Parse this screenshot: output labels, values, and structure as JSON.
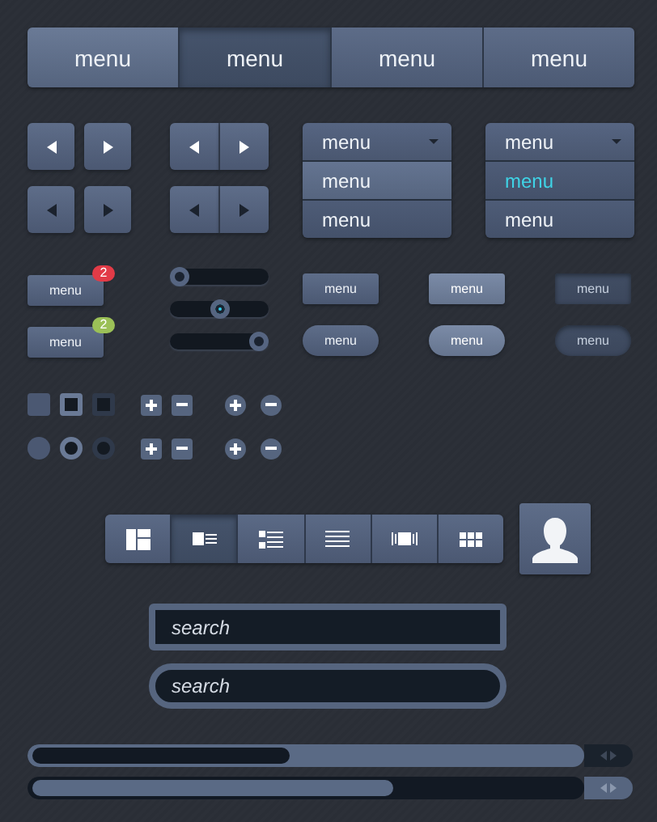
{
  "tabs": [
    {
      "label": "menu",
      "selected": false
    },
    {
      "label": "menu",
      "selected": true
    },
    {
      "label": "menu",
      "selected": false
    },
    {
      "label": "menu",
      "selected": false
    }
  ],
  "pagers": [
    {
      "joined": false,
      "dark_arrows": false
    },
    {
      "joined": true,
      "dark_arrows": false
    },
    {
      "joined": false,
      "dark_arrows": true
    },
    {
      "joined": true,
      "dark_arrows": true
    }
  ],
  "dropdowns": [
    {
      "label": "menu",
      "items": [
        {
          "label": "menu",
          "hovered": true,
          "selected": false
        },
        {
          "label": "menu",
          "hovered": false,
          "selected": false
        }
      ]
    },
    {
      "label": "menu",
      "items": [
        {
          "label": "menu",
          "hovered": false,
          "selected": true
        },
        {
          "label": "menu",
          "hovered": false,
          "selected": false
        }
      ]
    }
  ],
  "badge_buttons": [
    {
      "label": "menu",
      "badge": "2",
      "color": "#e23b47"
    },
    {
      "label": "menu",
      "badge": "2",
      "color": "#9bc057"
    }
  ],
  "sliders": [
    {
      "level": 0,
      "active": false
    },
    {
      "level": 0.5,
      "active": true
    },
    {
      "level": 1,
      "active": false
    }
  ],
  "buttons": [
    {
      "label": "menu",
      "kind": "square",
      "hovered": false,
      "pressed": false
    },
    {
      "label": "menu",
      "kind": "square",
      "hovered": true,
      "pressed": false
    },
    {
      "label": "menu",
      "kind": "square",
      "hovered": false,
      "pressed": true
    },
    {
      "label": "menu",
      "kind": "round",
      "hovered": false,
      "pressed": false
    },
    {
      "label": "menu",
      "kind": "round",
      "hovered": true,
      "pressed": false
    },
    {
      "label": "menu",
      "kind": "round",
      "hovered": false,
      "pressed": true
    }
  ],
  "checkboxes": [
    {
      "checked": false,
      "focused": false
    },
    {
      "checked": true,
      "focused": true
    },
    {
      "checked": true,
      "focused": false
    }
  ],
  "radios": [
    {
      "checked": false,
      "focused": false
    },
    {
      "checked": true,
      "focused": true
    },
    {
      "checked": true,
      "focused": false
    }
  ],
  "view_toggle": [
    {
      "kind": "tiles",
      "selected": false
    },
    {
      "kind": "media",
      "selected": true
    },
    {
      "kind": "bullets",
      "selected": false
    },
    {
      "kind": "lines",
      "selected": false
    },
    {
      "kind": "carousel",
      "selected": false
    },
    {
      "kind": "grid",
      "selected": false
    }
  ],
  "search_fields": [
    {
      "placeholder": "search",
      "kind": "square"
    },
    {
      "placeholder": "search",
      "kind": "round"
    }
  ],
  "scrollbars": [
    {
      "inverted": false
    },
    {
      "inverted": true
    }
  ]
}
